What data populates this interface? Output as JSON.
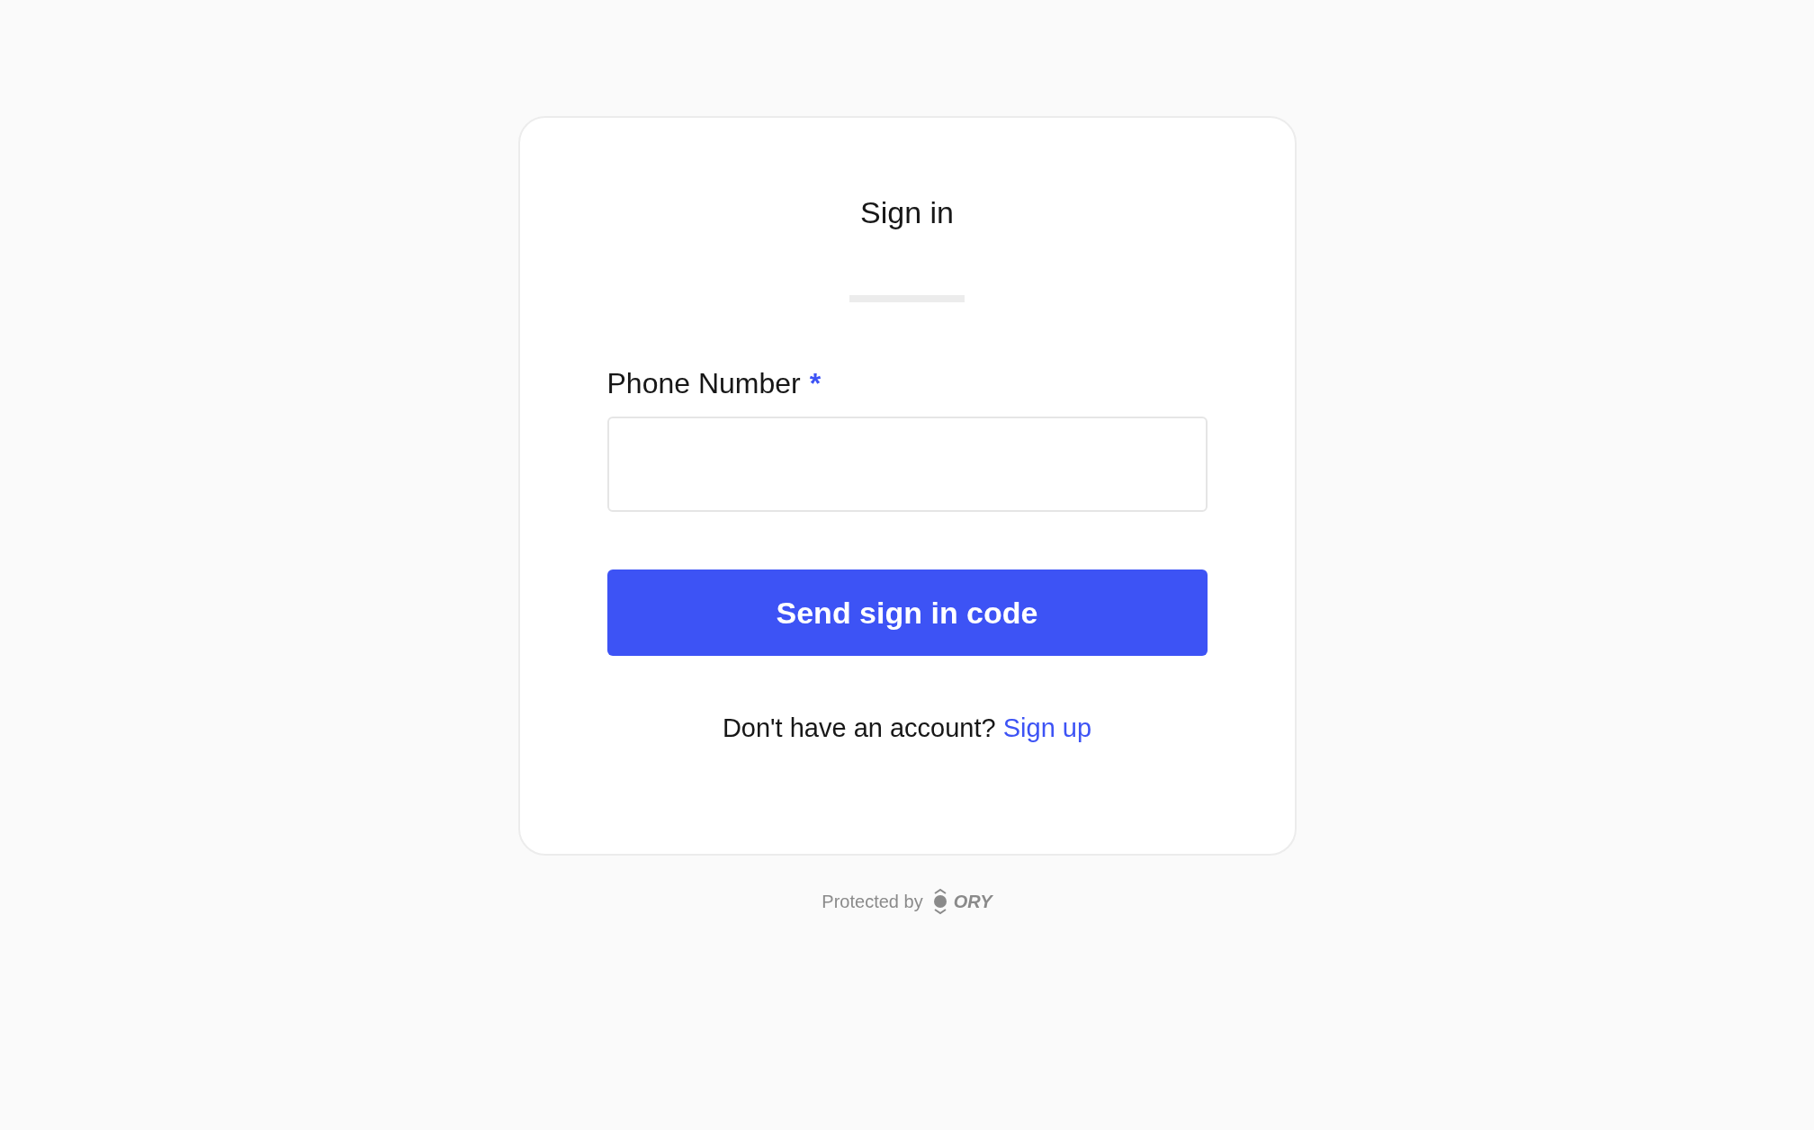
{
  "card": {
    "title": "Sign in",
    "field": {
      "label": "Phone Number",
      "required_mark": "*"
    },
    "submit_button": "Send sign in code",
    "prompt": {
      "text": "Don't have an account?",
      "link": "Sign up"
    }
  },
  "footer": {
    "text": "Protected by",
    "logo_text": "ORY"
  }
}
